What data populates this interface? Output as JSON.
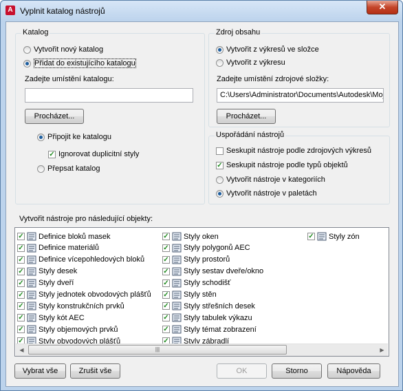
{
  "window": {
    "title": "Vyplnit katalog nástrojů",
    "close_glyph": "✕"
  },
  "katalog": {
    "legend": "Katalog",
    "radio_new": "Vytvořit nový katalog",
    "radio_add": "Přidat do existujícího katalogu",
    "location_label": "Zadejte umístění katalogu:",
    "location_value": "",
    "browse": "Procházet...",
    "radio_attach": "Připojit ke katalogu",
    "check_ignore": "Ignorovat duplicitní styly",
    "radio_overwrite": "Přepsat katalog"
  },
  "zdroj": {
    "legend": "Zdroj obsahu",
    "radio_folder": "Vytvořit z výkresů ve složce",
    "radio_drawing": "Vytvořit z výkresu",
    "folder_label": "Zadejte umístění zdrojové složky:",
    "folder_value": "C:\\Users\\Administrator\\Documents\\Autodesk\\Moj",
    "browse": "Procházet..."
  },
  "usporadani": {
    "legend": "Uspořádání nástrojů",
    "check_source": "Seskupit nástroje podle zdrojových výkresů",
    "check_type": "Seskupit nástroje podle typů objektů",
    "radio_categories": "Vytvořit nástroje v kategoriích",
    "radio_palettes": "Vytvořit nástroje v paletách"
  },
  "objects": {
    "label": "Vytvořit nástroje pro následující objekty:",
    "col1": [
      "Definice bloků masek",
      "Definice materiálů",
      "Definice vícepohledových bloků",
      "Styly desek",
      "Styly dveří",
      "Styly jednotek obvodových plášťů",
      "Styly konstrukčních prvků",
      "Styly kót AEC",
      "Styly objemových prvků",
      "Styly obvodových plášťů"
    ],
    "col2": [
      "Styly oken",
      "Styly polygonů AEC",
      "Styly prostorů",
      "Styly sestav dveře/okno",
      "Styly schodišť",
      "Styly stěn",
      "Styly střešních desek",
      "Styly tabulek výkazu",
      "Styly témat zobrazení",
      "Styly zábradlí"
    ],
    "col3": [
      "Styly zón"
    ],
    "check_glyph": "✓",
    "thumb_glyph": "|||",
    "left_glyph": "◀",
    "right_glyph": "▶"
  },
  "footer": {
    "select_all": "Vybrat vše",
    "clear_all": "Zrušit vše",
    "ok": "OK",
    "cancel": "Storno",
    "help": "Nápověda"
  }
}
